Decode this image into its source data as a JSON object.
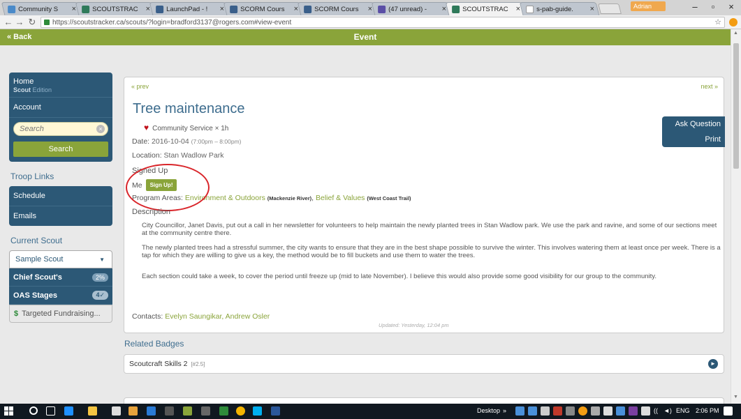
{
  "browser": {
    "tabs": [
      {
        "title": "Community S",
        "favicon": "doc-blue"
      },
      {
        "title": "SCOUTSTRAC",
        "favicon": "scoutstracker"
      },
      {
        "title": "LaunchPad - !",
        "favicon": "launchpad"
      },
      {
        "title": "SCORM Cours",
        "favicon": "scorm"
      },
      {
        "title": "SCORM Cours",
        "favicon": "scorm"
      },
      {
        "title": "(47 unread) -",
        "favicon": "mail"
      },
      {
        "title": "SCOUTSTRAC",
        "favicon": "scoutstracker",
        "active": true
      },
      {
        "title": "s-pab-guide.",
        "favicon": "doc"
      }
    ],
    "user_name": "Adrian",
    "url": "https://scoutstracker.ca/scouts/?login=bradford3137@rogers.com#view-event"
  },
  "header": {
    "back_label": "« Back",
    "title": "Event"
  },
  "sidebar": {
    "home_label": "Home",
    "edition_brand": "Scout",
    "edition_suffix": " Edition",
    "account_label": "Account",
    "search_placeholder": "Search",
    "search_button": "Search",
    "troop_links_title": "Troop Links",
    "troop_links": [
      "Schedule",
      "Emails"
    ],
    "current_scout_title": "Current Scout",
    "current_scout_value": "Sample Scout",
    "progress": [
      {
        "label": "Chief Scout's",
        "badge": "2%"
      },
      {
        "label": "OAS Stages",
        "badge": "4✓"
      }
    ],
    "fundraising_label": "Targeted Fundraising..."
  },
  "event": {
    "prev_label": "« prev",
    "next_label": "next »",
    "title": "Tree maintenance",
    "actions": [
      "Ask Question",
      "Print"
    ],
    "category": "Community Service × 1h",
    "date_key": "Date:",
    "date_value": "2016-10-04",
    "time_range": "(7:00pm – 8:00pm)",
    "location_key": "Location:",
    "location_value": "Stan Wadlow Park",
    "signed_up_title": "Signed Up",
    "signed_up_me": "Me",
    "signup_button": "Sign Up!",
    "program_key": "Program Areas:",
    "program_areas": [
      {
        "name": "Environment & Outdoors",
        "tag": "(Mackenzie River)"
      },
      {
        "name": "Belief & Values",
        "tag": "(West Coast Trail)"
      }
    ],
    "description_title": "Description",
    "description": [
      "City Councillor, Janet Davis, put out a call in her newsletter for volunteers to help maintain the newly planted trees in Stan Wadlow park. We use the park and ravine, and some of our sections meet at the community centre there.",
      "The newly planted trees had a stressful summer, the city wants to ensure that they are in the best shape possible to survive the winter. This involves watering them at least once per week. There is a tap for which they are willing to give us a key, the method would be to fill buckets and use them to water the trees.",
      "Each section could take a week, to cover the period until freeze up (mid to late November). I believe this would also provide some good visibility for our group to the community."
    ],
    "contacts_key": "Contacts:",
    "contacts": "Evelyn Saungikar, Andrew Osler",
    "updated": "Updated: Yesterday, 12:04 pm"
  },
  "related": {
    "title": "Related Badges",
    "badges": [
      {
        "name": "Scoutcraft Skills 2",
        "tag": "[#2.5]"
      }
    ]
  },
  "taskbar": {
    "desktop_label": "Desktop",
    "language": "ENG",
    "time": "2:06 PM"
  },
  "colors": {
    "brand_green": "#8aa43a",
    "navy": "#2c5876",
    "title_blue": "#3e6d8e",
    "annotation_red": "#d9252a"
  }
}
